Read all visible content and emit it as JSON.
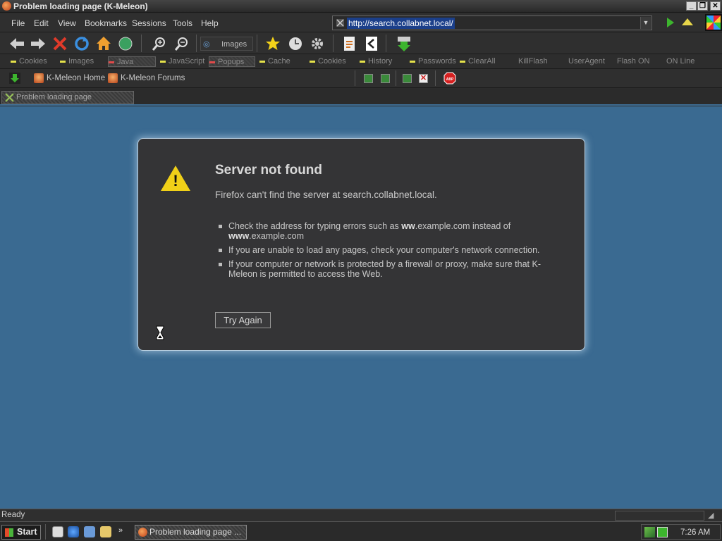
{
  "window": {
    "title": "Problem loading page (K-Meleon)",
    "controls": [
      "_",
      "❐",
      "✕"
    ]
  },
  "menu": {
    "items": [
      "File",
      "Edit",
      "View",
      "Bookmarks",
      "Sessions",
      "Tools",
      "Help"
    ]
  },
  "urlbar": {
    "value": "http://search.collabnet.local/"
  },
  "toolbar": {
    "images_label": "Images"
  },
  "privacy_bar": {
    "items": [
      "Cookies",
      "Images",
      "Java",
      "JavaScript",
      "Popups",
      "Cache",
      "Cookies",
      "History",
      "Passwords",
      "ClearAll",
      "KillFlash",
      "UserAgent",
      "Flash ON",
      "ON Line"
    ]
  },
  "bookmarks": {
    "items": [
      "K-Meleon Home",
      "K-Meleon Forums"
    ]
  },
  "tabs": [
    {
      "label": "Problem loading page"
    }
  ],
  "error_page": {
    "title": "Server not found",
    "description": "Firefox can't find the server at search.collabnet.local.",
    "suggestions": [
      {
        "pre": "Check the address for typing errors such as ",
        "b1": "ww",
        "mid": ".example.com instead of ",
        "b2": "www",
        "post": ".example.com"
      },
      {
        "text": "If you are unable to load any pages, check your computer's network connection."
      },
      {
        "text": "If your computer or network is protected by a firewall or proxy, make sure that K-Meleon is permitted to access the Web."
      }
    ],
    "try_again_label": "Try Again"
  },
  "status_bar": {
    "text": "Ready"
  },
  "taskbar": {
    "start_label": "Start",
    "task_label": "Problem loading page ...",
    "clock": "7:26 AM"
  },
  "colors": {
    "content_bg": "#3a6a91",
    "error_box_bg": "#343436",
    "warning": "#f0d018"
  }
}
